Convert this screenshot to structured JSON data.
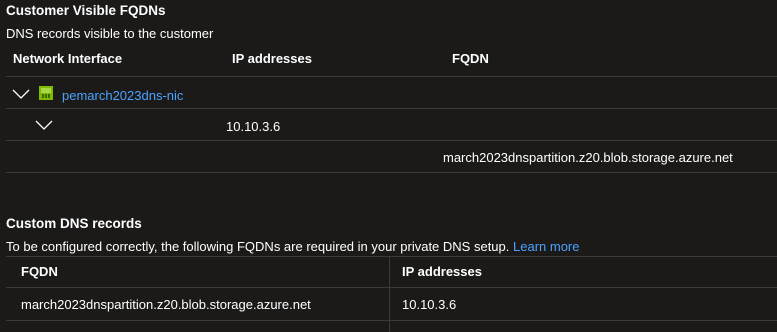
{
  "fqdn_section": {
    "title": "Customer Visible FQDNs",
    "description": "DNS records visible to the customer",
    "columns": [
      "Network Interface",
      "IP addresses",
      "FQDN"
    ],
    "nic_name": "pemarch2023dns-nic",
    "ip_address": "10.10.3.6",
    "fqdn": "march2023dnspartition.z20.blob.storage.azure.net"
  },
  "dns_section": {
    "title": "Custom DNS records",
    "description": "To be configured correctly, the following FQDNs are required in your private DNS setup.",
    "learn_more": "Learn more",
    "columns": [
      "FQDN",
      "IP addresses"
    ],
    "rows": [
      {
        "fqdn": "march2023dnspartition.z20.blob.storage.azure.net",
        "ip": "10.10.3.6"
      }
    ]
  },
  "colors": {
    "background": "#1b1a19",
    "divider": "#3b3a39",
    "link": "#4aa3ff",
    "icon_green": "#7fba00"
  },
  "icons": [
    "chevron-down-icon",
    "network-interface-icon"
  ]
}
